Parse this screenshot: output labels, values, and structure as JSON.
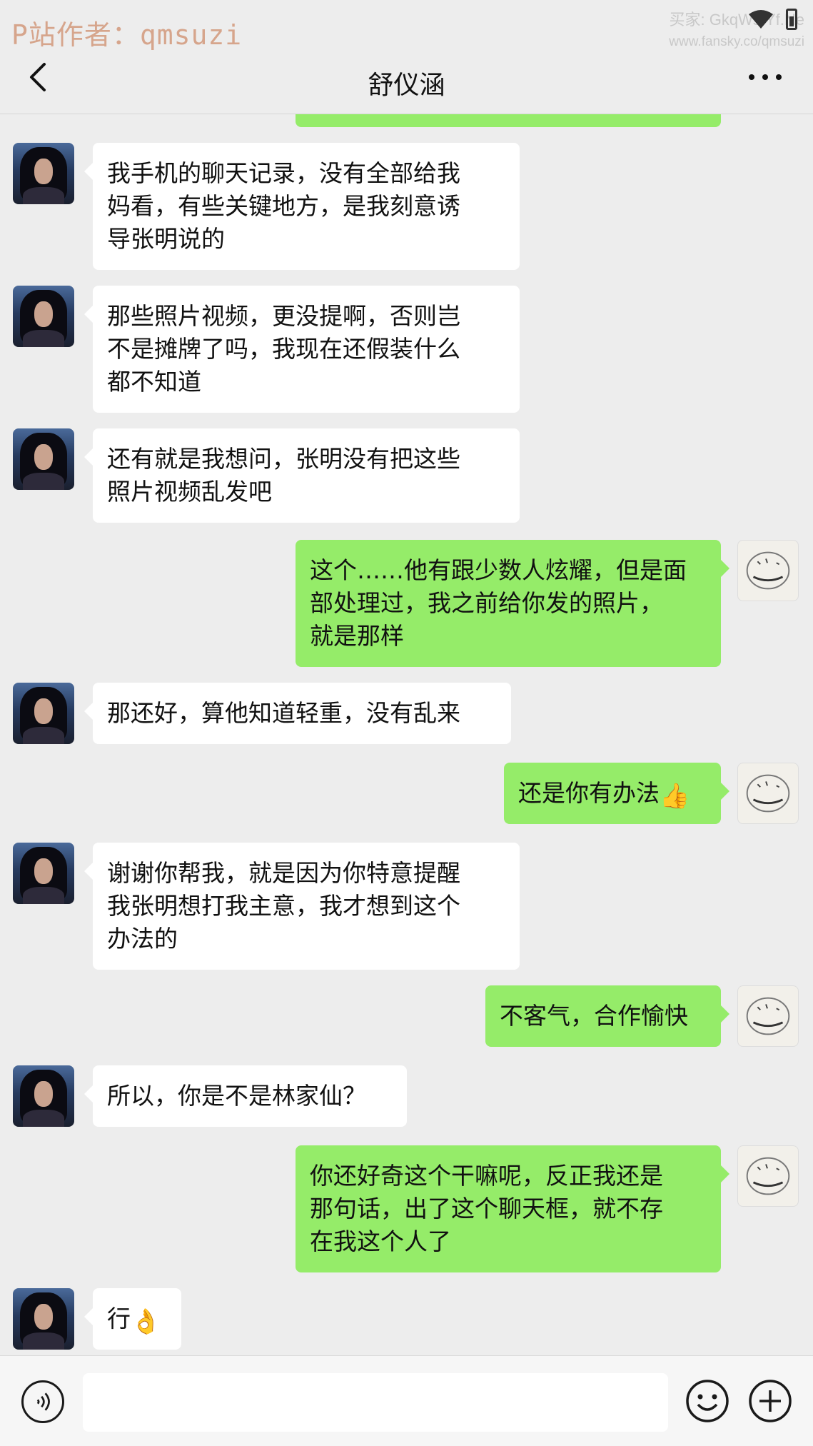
{
  "watermark": {
    "left": "P站作者：qmsuzi",
    "right_line1": "买家: GkqWs.Yf.Ne",
    "right_line2": "www.fansky.co/qmsuzi"
  },
  "header": {
    "title": "舒仪涵"
  },
  "messages": [
    {
      "side": "in",
      "text": "我手机的聊天记录，没有全部给我\n妈看，有些关键地方，是我刻意诱\n导张明说的"
    },
    {
      "side": "in",
      "text": "那些照片视频，更没提啊，否则岂\n不是摊牌了吗，我现在还假装什么\n都不知道"
    },
    {
      "side": "in",
      "text": "还有就是我想问，张明没有把这些\n照片视频乱发吧"
    },
    {
      "side": "out",
      "text": "这个……他有跟少数人炫耀，但是面\n部处理过，我之前给你发的照片，\n就是那样"
    },
    {
      "side": "in",
      "text": "那还好，算他知道轻重，没有乱来"
    },
    {
      "side": "out",
      "text": "还是你有办法",
      "emoji": "👍"
    },
    {
      "side": "in",
      "text": "谢谢你帮我，就是因为你特意提醒\n我张明想打我主意，我才想到这个\n办法的"
    },
    {
      "side": "out",
      "text": "不客气，合作愉快"
    },
    {
      "side": "in",
      "text": "所以，你是不是林家仙？"
    },
    {
      "side": "out",
      "text": "你还好奇这个干嘛呢，反正我还是\n那句话，出了这个聊天框，就不存\n在我这个人了"
    },
    {
      "side": "in",
      "text": "行",
      "emoji": "👌"
    }
  ],
  "footer": {
    "input_value": "",
    "input_placeholder": ""
  },
  "colors": {
    "incoming_bubble": "#ffffff",
    "outgoing_bubble": "#95ec69",
    "background": "#ededed"
  },
  "icons": [
    "back-arrow-icon",
    "more-dots-icon",
    "voice-icon",
    "emoji-icon",
    "plus-icon",
    "wifi-icon",
    "battery-icon"
  ]
}
